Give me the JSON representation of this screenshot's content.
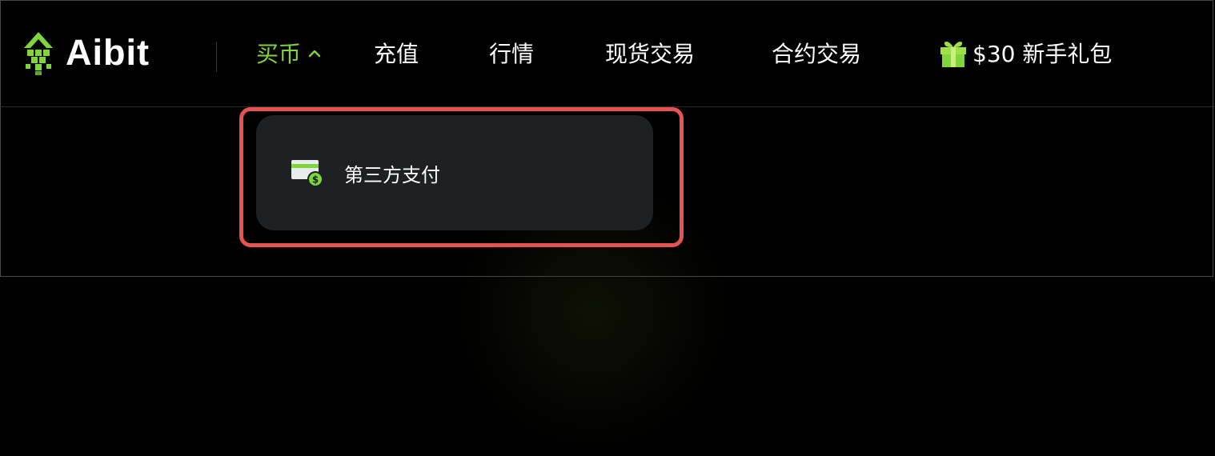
{
  "header": {
    "logo": {
      "text": "Aibit",
      "icon": "aibit-logo-icon",
      "color": "#7fd63a"
    },
    "nav": {
      "items": [
        {
          "label": "买币",
          "active": true,
          "icon": "chevron-up-icon"
        },
        {
          "label": "充值"
        },
        {
          "label": "行情"
        },
        {
          "label": "现货交易"
        },
        {
          "label": "合约交易"
        },
        {
          "label": "$30 新手礼包",
          "icon": "gift-icon"
        }
      ]
    }
  },
  "dropdown": {
    "items": [
      {
        "label": "第三方支付",
        "icon": "payment-card-icon"
      }
    ]
  },
  "colors": {
    "accent": "#7fd63a",
    "background": "#000000",
    "dropdown_bg": "#1e2024",
    "highlight_border": "#e55353"
  }
}
